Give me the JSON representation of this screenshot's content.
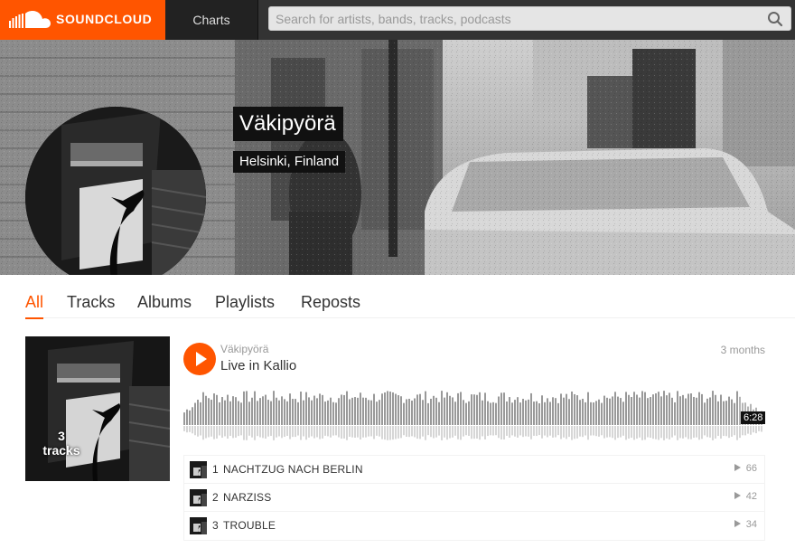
{
  "header": {
    "brand": "SOUNDCLOUD",
    "nav_charts": "Charts",
    "search_placeholder": "Search for artists, bands, tracks, podcasts",
    "accent_color": "#ff5500"
  },
  "profile": {
    "name": "Väkipyörä",
    "location": "Helsinki, Finland"
  },
  "tabs": [
    {
      "label": "All",
      "active": true
    },
    {
      "label": "Tracks",
      "active": false
    },
    {
      "label": "Albums",
      "active": false
    },
    {
      "label": "Playlists",
      "active": false
    },
    {
      "label": "Reposts",
      "active": false
    }
  ],
  "playlist": {
    "track_count": "3",
    "track_count_label": "tracks",
    "uploader": "Väkipyörä",
    "title": "Live in Kallio",
    "posted": "3 months",
    "duration": "6:28",
    "progress": 0.96,
    "tracks": [
      {
        "number": "1",
        "title": "NACHTZUG NACH BERLIN",
        "plays": "66"
      },
      {
        "number": "2",
        "title": "NARZISS",
        "plays": "42"
      },
      {
        "number": "3",
        "title": "TROUBLE",
        "plays": "34"
      }
    ]
  }
}
